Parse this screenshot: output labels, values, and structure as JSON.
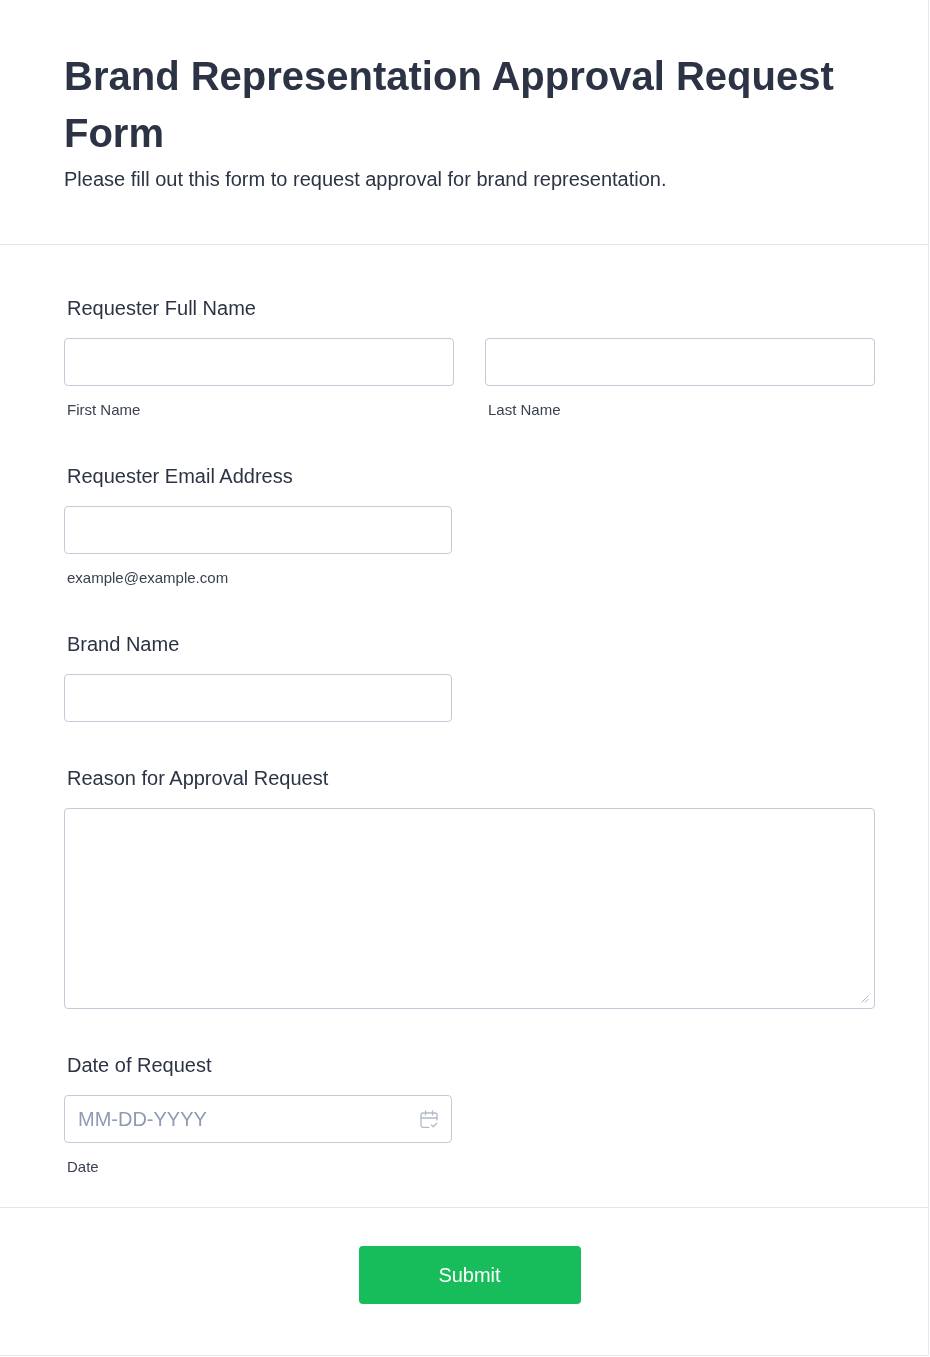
{
  "header": {
    "title": "Brand Representation Approval Request Form",
    "description": "Please fill out this form to request approval for brand representation."
  },
  "fields": [
    {
      "kind": "name",
      "label": "Requester Full Name",
      "inputs": [
        {
          "sublabel": "First Name"
        },
        {
          "sublabel": "Last Name"
        }
      ]
    },
    {
      "kind": "text",
      "label": "Requester Email Address",
      "inputs": [
        {
          "sublabel": "example@example.com"
        }
      ]
    },
    {
      "kind": "text",
      "label": "Brand Name"
    },
    {
      "kind": "textarea",
      "label": "Reason for Approval Request"
    },
    {
      "kind": "date",
      "label": "Date of Request",
      "inputs": [
        {
          "placeholder": "MM-DD-YYYY",
          "sublabel": "Date"
        }
      ]
    }
  ],
  "submit": {
    "label": "Submit"
  }
}
